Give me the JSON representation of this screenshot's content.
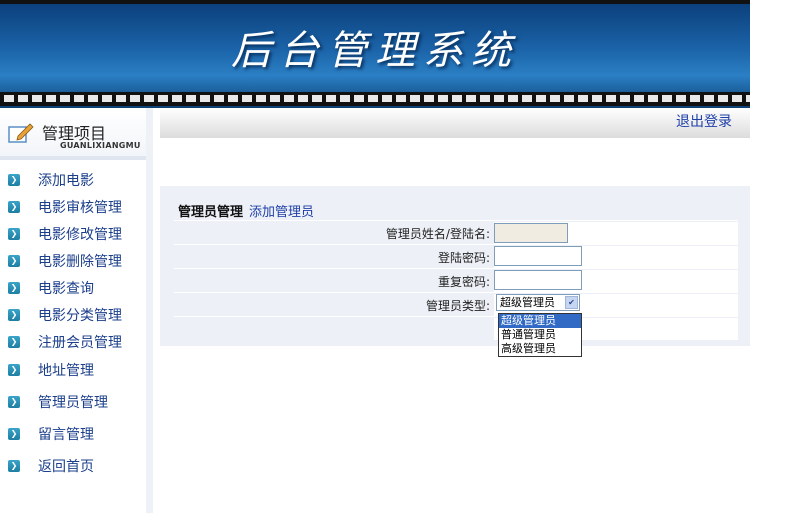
{
  "banner": {
    "title": "后台管理系统"
  },
  "sidebar": {
    "title": "管理项目",
    "subtitle": "GUANLIXIANGMU",
    "items": [
      {
        "label": "添加电影",
        "icon": "arrow-bullet-icon"
      },
      {
        "label": "电影审核管理",
        "icon": "arrow-bullet-icon"
      },
      {
        "label": "电影修改管理",
        "icon": "arrow-bullet-icon"
      },
      {
        "label": "电影删除管理",
        "icon": "arrow-bullet-icon"
      },
      {
        "label": "电影查询",
        "icon": "arrow-bullet-icon"
      },
      {
        "label": "电影分类管理",
        "icon": "arrow-bullet-icon"
      },
      {
        "label": "注册会员管理",
        "icon": "arrow-bullet-icon"
      },
      {
        "label": "地址管理",
        "icon": "arrow-bullet-icon"
      },
      {
        "label": "管理员管理",
        "icon": "arrow-bullet-icon"
      },
      {
        "label": "留言管理",
        "icon": "arrow-bullet-icon"
      },
      {
        "label": "返回首页",
        "icon": "arrow-bullet-icon"
      }
    ]
  },
  "topbar": {
    "logout": "退出登录"
  },
  "main": {
    "breadcrumb": {
      "section": "管理员管理",
      "action": "添加管理员"
    },
    "form": {
      "name_label": "管理员姓名/登陆名:",
      "password_label": "登陆密码:",
      "repeat_label": "重复密码:",
      "type_label": "管理员类型:",
      "type_selected": "超级管理员",
      "type_options": [
        "超级管理员",
        "普通管理员",
        "高级管理员"
      ]
    }
  },
  "colors": {
    "link": "#1f3fa8",
    "panel": "#edf1f7",
    "highlight": "#316ac5"
  }
}
